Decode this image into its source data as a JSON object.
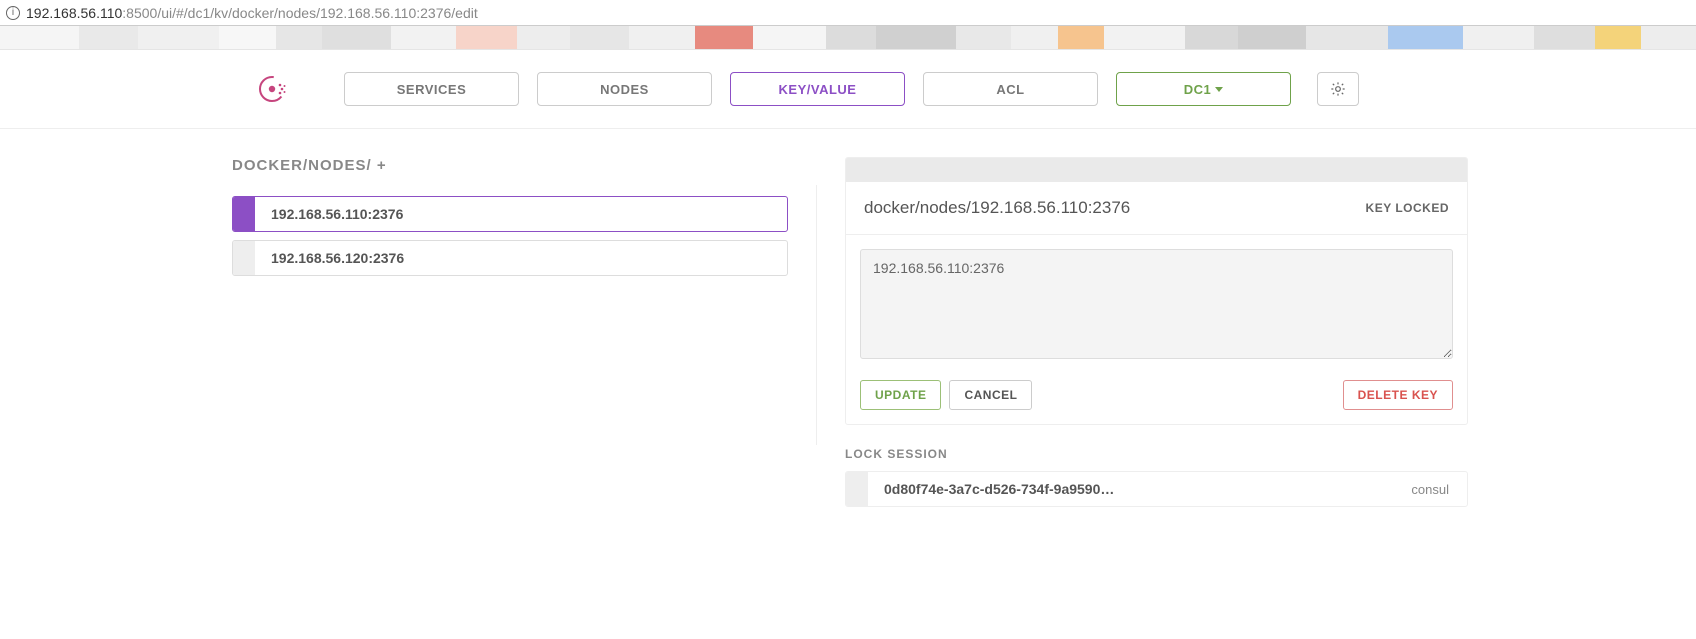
{
  "url": {
    "host": "192.168.56.110",
    "rest": ":8500/ui/#/dc1/kv/docker/nodes/192.168.56.110:2376/edit"
  },
  "nav": {
    "services": "SERVICES",
    "nodes": "NODES",
    "kv": "KEY/VALUE",
    "acl": "ACL",
    "dc": "DC1"
  },
  "breadcrumb": {
    "seg1": "DOCKER/",
    "seg2": "NODES/",
    "plus": " +"
  },
  "kv_list": [
    {
      "key": "192.168.56.110:2376",
      "selected": true
    },
    {
      "key": "192.168.56.120:2376",
      "selected": false
    }
  ],
  "editor": {
    "path": "docker/nodes/192.168.56.110:2376",
    "locked_label": "KEY LOCKED",
    "value": "192.168.56.110:2376",
    "update": "UPDATE",
    "cancel": "CANCEL",
    "delete": "DELETE KEY"
  },
  "lock": {
    "heading": "LOCK SESSION",
    "session_id": "0d80f74e-3a7c-d526-734f-9a9590…",
    "node": "consul"
  },
  "pixel_bar_colors": [
    "#f5f5f5",
    "#e9e9e9",
    "#f0f0f0",
    "#f7f7f7",
    "#e6e6e6",
    "#dfdfdf",
    "#f2f2f2",
    "#f7d4c9",
    "#ededed",
    "#e6e6e6",
    "#f0f0f0",
    "#e78a7f",
    "#f5f5f5",
    "#dcdcdc",
    "#d0d0d0",
    "#e8e8e8",
    "#f0f0f0",
    "#f6c48e",
    "#f2f2f2",
    "#d8d8d8",
    "#cfcfcf",
    "#e6e6e6",
    "#aac9ef",
    "#f0f0f0",
    "#dedede",
    "#f4d37a",
    "#ededed"
  ]
}
